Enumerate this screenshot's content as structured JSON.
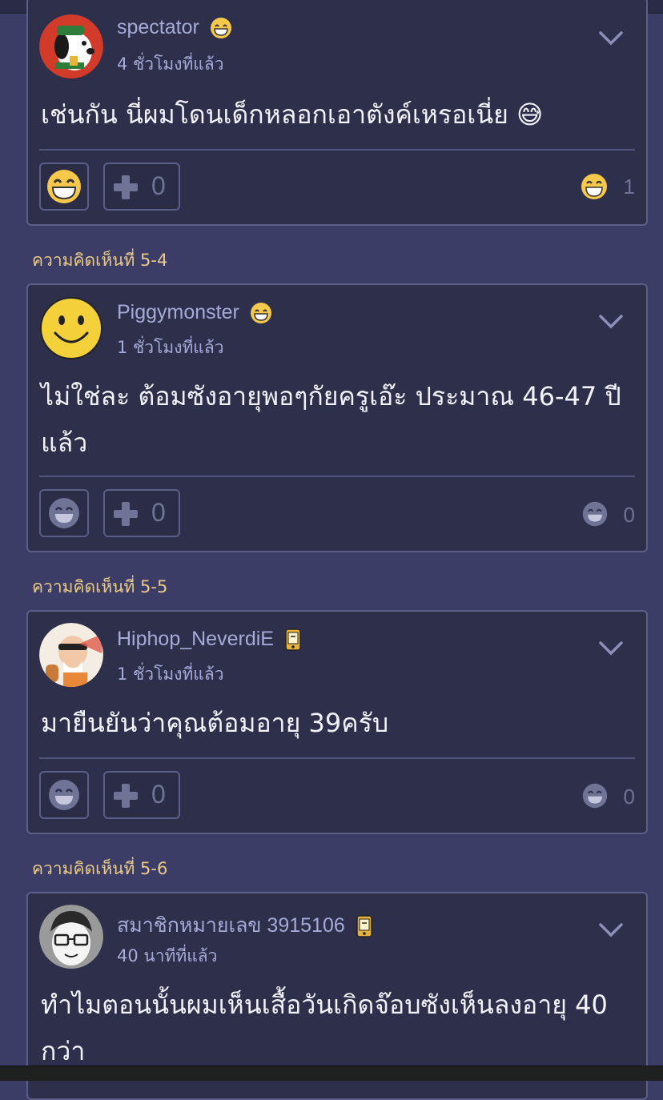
{
  "comments": [
    {
      "username": "spectator",
      "time": "4 ชั่วโมงที่แล้ว",
      "text": "เช่นกัน นี่ผมโดนเด็กหลอกเอาตังค์เหรอเนี่ย 😅",
      "plus_count": "0",
      "reaction_count": "1",
      "badge_icon": "grin-emoji-icon"
    },
    {
      "label": "ความคิดเห็นที่ 5-4",
      "username": "Piggymonster",
      "time": "1 ชั่วโมงที่แล้ว",
      "text": "ไม่ใช่ละ ต้อมซังอายุพอๆกัยครูเอ๊ะ ประมาณ 46-47 ปีแล้ว",
      "plus_count": "0",
      "reaction_count": "0",
      "badge_icon": "grin-emoji-icon"
    },
    {
      "label": "ความคิดเห็นที่ 5-5",
      "username": "Hiphop_NeverdiE",
      "time": "1 ชั่วโมงที่แล้ว",
      "text": "มายืนยันว่าคุณต้อมอายุ 39ครับ",
      "plus_count": "0",
      "reaction_count": "0",
      "badge_icon": "mobile-phone-icon"
    },
    {
      "label": "ความคิดเห็นที่ 5-6",
      "username": "สมาชิกหมายเลข 3915106",
      "time": "40 นาทีที่แล้ว",
      "text": "ทำไมตอนนั้นผมเห็นเสื้อวันเกิดจ๊อบซังเห็นลงอายุ 40 กว่า",
      "badge_icon": "mobile-phone-icon"
    }
  ],
  "colors": {
    "background": "#3c3d66",
    "card": "#2e2f4a",
    "username": "#a5abd8",
    "section_label": "#e8c98a"
  }
}
